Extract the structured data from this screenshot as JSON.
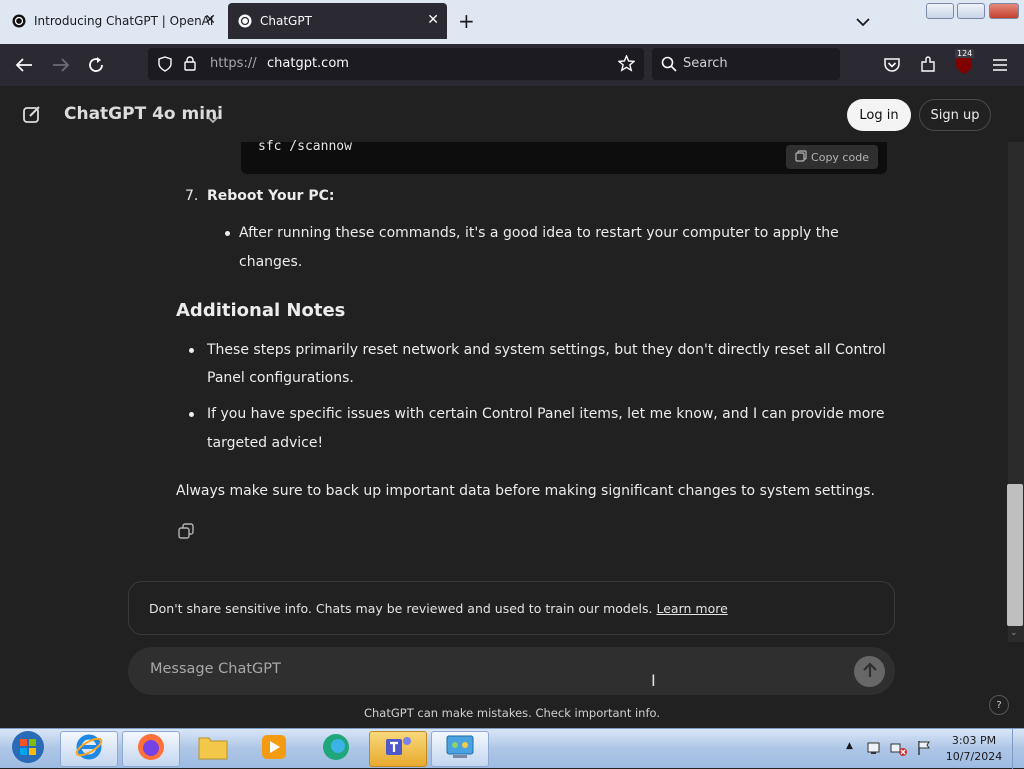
{
  "browser": {
    "tabs": [
      {
        "title": "Introducing ChatGPT | OpenAI",
        "active": false
      },
      {
        "title": "ChatGPT",
        "active": true
      }
    ],
    "url_prefix": "https://",
    "url_host": "chatgpt.com",
    "search_placeholder": "Search",
    "extension_badge": "124"
  },
  "chat": {
    "model_name": "ChatGPT 4o mini",
    "login_label": "Log in",
    "signup_label": "Sign up",
    "code": "sfc /scannow",
    "copy_code_label": "Copy code",
    "step7_number": "7.",
    "step7_title": "Reboot Your PC:",
    "step7_bullet_line1": "After running these commands, it's a good idea to restart your computer to apply the",
    "step7_bullet_line2": "changes.",
    "notes_heading": "Additional Notes",
    "note1_line1": "These steps primarily reset network and system settings, but they don't directly reset all Control",
    "note1_line2": "Panel configurations.",
    "note2_line1": "If you have specific issues with certain Control Panel items, let me know, and I can provide more",
    "note2_line2": "targeted advice!",
    "closing": "Always make sure to back up important data before making significant changes to system settings.",
    "notice_text": "Don't share sensitive info. Chats may be reviewed and used to train our models.",
    "learn_more": "Learn more",
    "composer_placeholder": "Message ChatGPT",
    "disclaimer": "ChatGPT can make mistakes. Check important info.",
    "help_label": "?"
  },
  "taskbar": {
    "time": "3:03 PM",
    "date": "10/7/2024",
    "apps": [
      "windows-start",
      "internet-explorer",
      "firefox",
      "file-explorer",
      "media-player",
      "edge",
      "teams",
      "control-panel"
    ]
  },
  "colors": {
    "page_bg": "#212121",
    "tabstrip_bg": "#dfe7f3",
    "nav_bg": "#2b2a33",
    "composer_bg": "#2f2f2f"
  }
}
